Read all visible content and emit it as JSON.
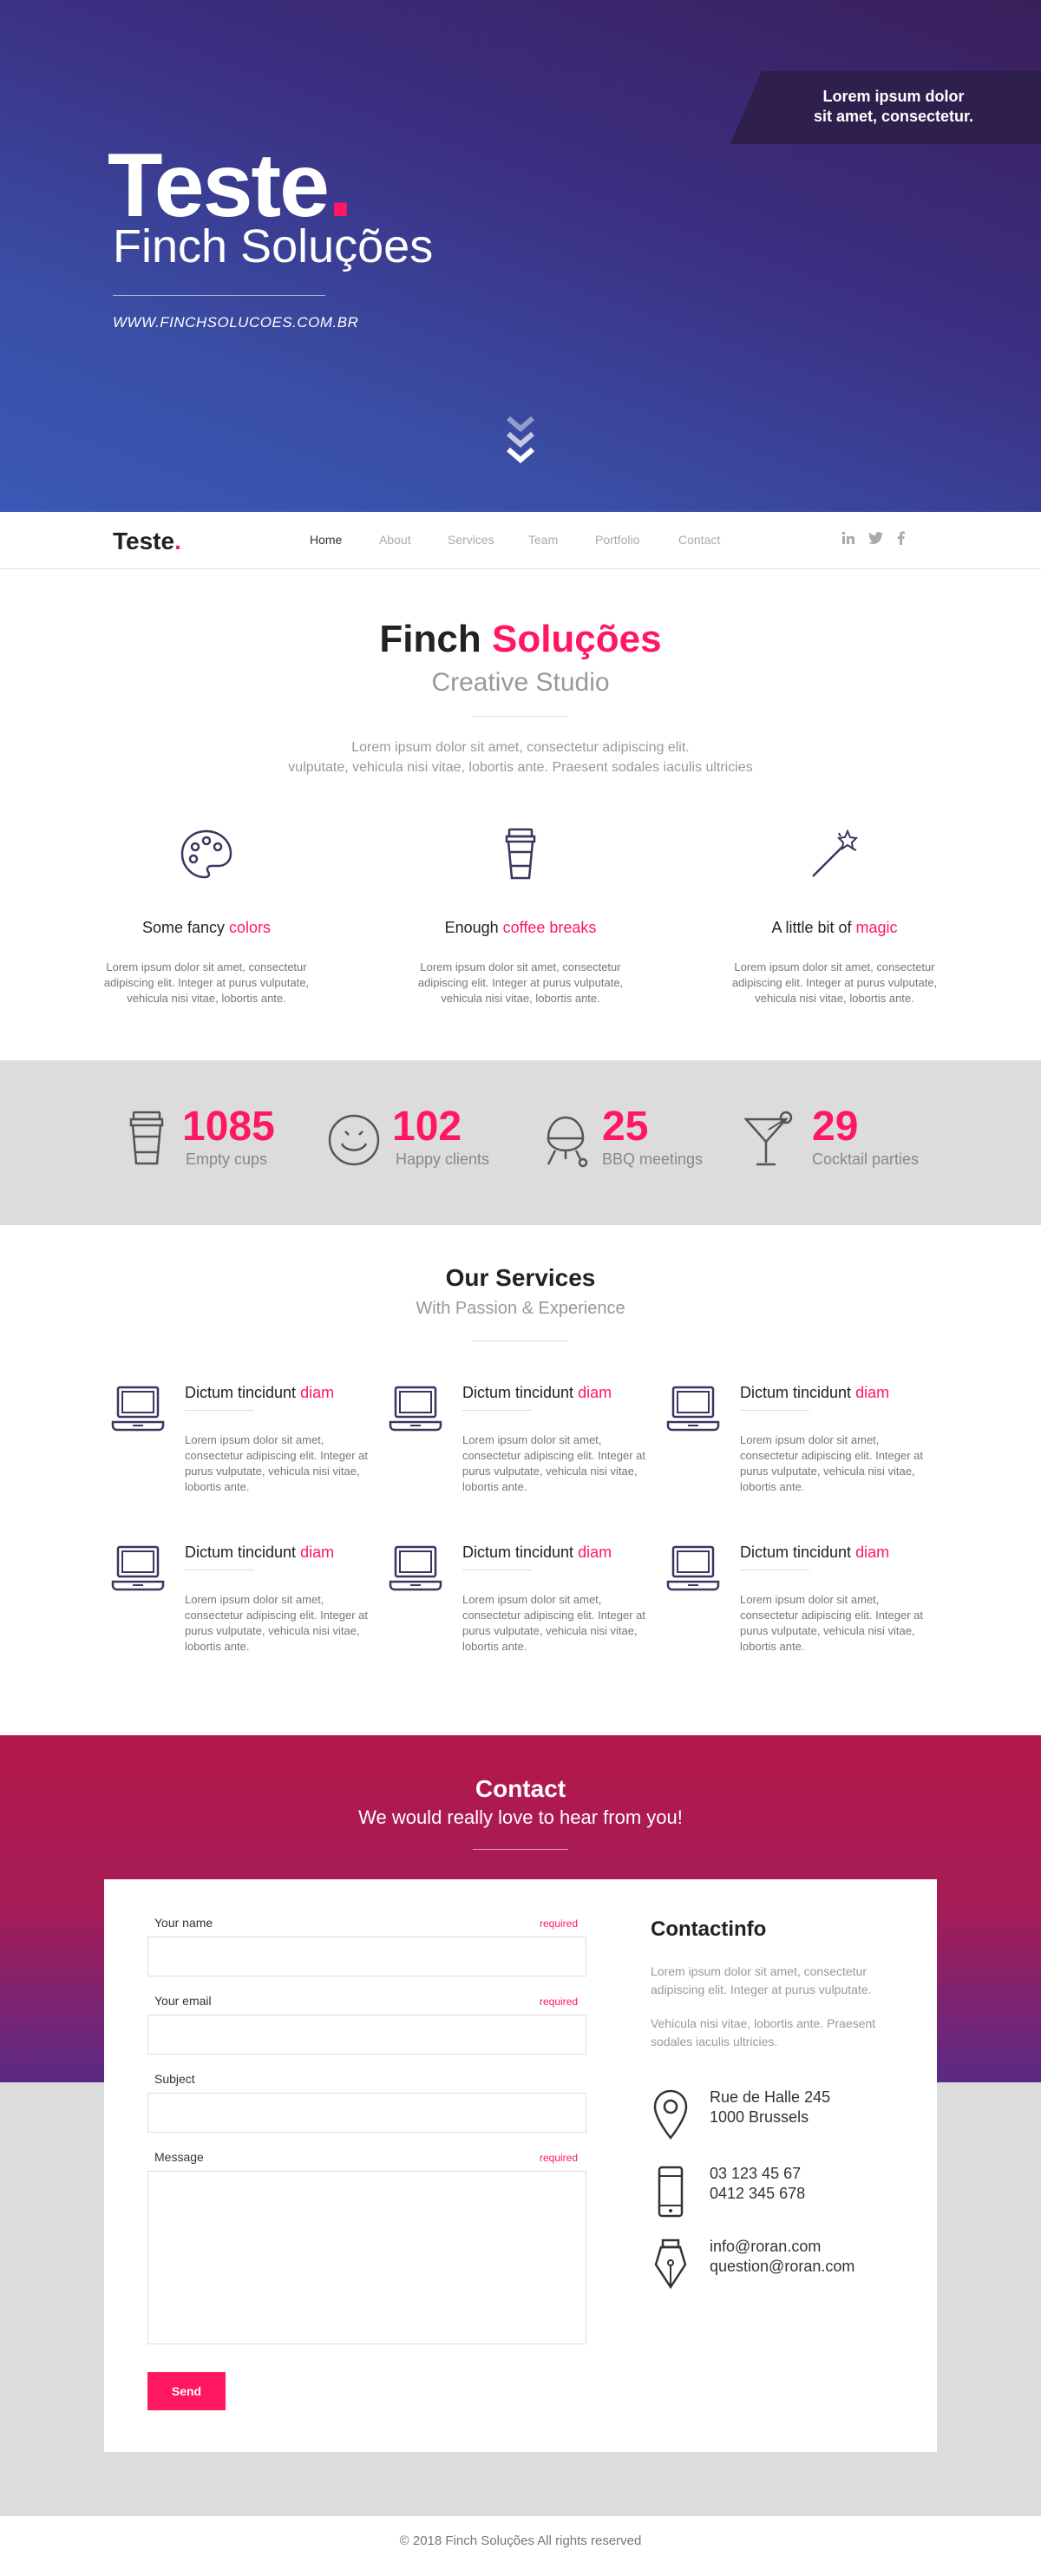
{
  "hero": {
    "banner": [
      "Lorem ipsum dolor",
      "sit amet, consectetur."
    ],
    "logo": "Teste",
    "logo_dot": ".",
    "subtitle": "Finch Soluções",
    "url": "WWW.FINCHSOLUCOES.COM.BR"
  },
  "nav": {
    "brand": "Teste",
    "brand_dot": ".",
    "items": [
      "Home",
      "About",
      "Services",
      "Team",
      "Portfolio",
      "Contact"
    ],
    "active": "Home",
    "social": [
      "linkedin-icon",
      "twitter-icon",
      "facebook-icon"
    ]
  },
  "intro": {
    "title_a": "Finch",
    "title_b": "Soluções",
    "subtitle": "Creative Studio",
    "text": [
      "Lorem ipsum dolor sit amet, consectetur adipiscing elit.",
      "vulputate, vehicula nisi vitae, lobortis ante. Praesent sodales iaculis ultricies"
    ]
  },
  "features": [
    {
      "icon": "palette-icon",
      "title": "Some fancy",
      "highlight": "colors",
      "text": "Lorem ipsum dolor sit amet, consectetur adipiscing elit. Integer at purus vulputate, vehicula nisi vitae, lobortis ante."
    },
    {
      "icon": "coffee-cup-icon",
      "title": "Enough",
      "highlight": "coffee breaks",
      "text": "Lorem ipsum dolor sit amet, consectetur adipiscing elit. Integer at purus vulputate, vehicula nisi vitae, lobortis ante."
    },
    {
      "icon": "magic-wand-icon",
      "title": "A little bit of",
      "highlight": "magic",
      "text": "Lorem ipsum dolor sit amet, consectetur adipiscing elit. Integer at purus vulputate, vehicula nisi vitae, lobortis ante."
    }
  ],
  "stats": [
    {
      "icon": "coffee-cup-icon",
      "number": "1085",
      "label": "Empty cups"
    },
    {
      "icon": "smiley-icon",
      "number": "102",
      "label": "Happy clients"
    },
    {
      "icon": "bbq-grill-icon",
      "number": "25",
      "label": "BBQ meetings"
    },
    {
      "icon": "cocktail-icon",
      "number": "29",
      "label": "Cocktail parties"
    }
  ],
  "services": {
    "title": "Our Services",
    "subtitle": "With Passion & Experience",
    "items": [
      {
        "icon": "laptop-icon",
        "title": "Dictum tincidunt",
        "highlight": "diam",
        "text": "Lorem ipsum dolor sit amet, consectetur adipiscing elit. Integer at purus vulputate, vehicula nisi vitae, lobortis ante."
      },
      {
        "icon": "laptop-icon",
        "title": "Dictum tincidunt",
        "highlight": "diam",
        "text": "Lorem ipsum dolor sit amet, consectetur adipiscing elit. Integer at purus vulputate, vehicula nisi vitae, lobortis ante."
      },
      {
        "icon": "laptop-icon",
        "title": "Dictum tincidunt",
        "highlight": "diam",
        "text": "Lorem ipsum dolor sit amet, consectetur adipiscing elit. Integer at purus vulputate, vehicula nisi vitae, lobortis ante."
      },
      {
        "icon": "laptop-icon",
        "title": "Dictum tincidunt",
        "highlight": "diam",
        "text": "Lorem ipsum dolor sit amet, consectetur adipiscing elit. Integer at purus vulputate, vehicula nisi vitae, lobortis ante."
      },
      {
        "icon": "laptop-icon",
        "title": "Dictum tincidunt",
        "highlight": "diam",
        "text": "Lorem ipsum dolor sit amet, consectetur adipiscing elit. Integer at purus vulputate, vehicula nisi vitae, lobortis ante."
      },
      {
        "icon": "laptop-icon",
        "title": "Dictum tincidunt",
        "highlight": "diam",
        "text": "Lorem ipsum dolor sit amet, consectetur adipiscing elit. Integer at purus vulputate, vehicula nisi vitae, lobortis ante."
      }
    ]
  },
  "contact": {
    "title": "Contact",
    "subtitle": "We would really love to hear from you!",
    "form": {
      "name_label": "Your name",
      "email_label": "Your email",
      "subject_label": "Subject",
      "message_label": "Message",
      "required": "required",
      "send": "Send"
    },
    "info": {
      "title": "Contactinfo",
      "text1": "Lorem ipsum dolor sit amet, consectetur adipiscing elit. Integer at purus vulputate.",
      "text2": "Vehicula nisi vitae, lobortis ante. Praesent sodales iaculis ultricies.",
      "address": [
        "Rue de Halle 245",
        "1000 Brussels"
      ],
      "phones": [
        "03 123 45 67",
        "0412 345 678"
      ],
      "emails": [
        "info@roran.com",
        "question@roran.com"
      ]
    }
  },
  "footer": "© 2018 Finch Soluções  All rights reserved",
  "colors": {
    "accent": "#ff1760",
    "hero_start": "#3a1f5a",
    "hero_end": "#3a58b6",
    "contact": "#b3184a",
    "grey": "#dcdcdc"
  }
}
